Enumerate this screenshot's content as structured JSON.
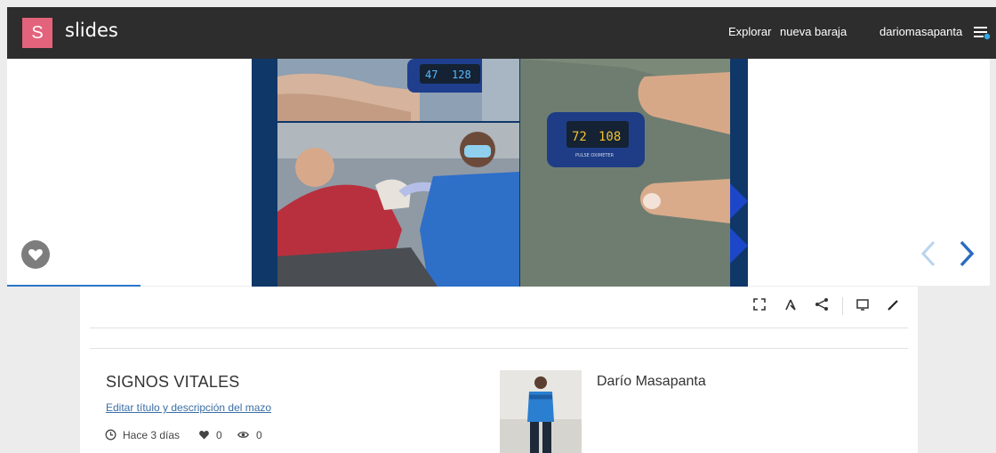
{
  "header": {
    "logo_letter": "S",
    "logo_text": "slides",
    "nav": {
      "explore": "Explorar",
      "new_deck": "nueva baraja",
      "user": "dariomasapanta"
    }
  },
  "deck": {
    "title": "SIGNOS VITALES",
    "edit_link": "Editar título y descripción del mazo",
    "time_ago": "Hace 3 días",
    "likes": "0",
    "views": "0",
    "author": "Darío Masapanta"
  },
  "slide": {
    "oximeter_top_reading_1": "47",
    "oximeter_top_reading_2": "128",
    "oximeter_right_reading_1": "72",
    "oximeter_right_reading_2": "108",
    "oximeter_label": "PULSE OXIMETER"
  },
  "toolbar_icons": [
    "fullscreen-icon",
    "fork-icon",
    "share-icon",
    "present-icon",
    "edit-icon"
  ],
  "colors": {
    "brand": "#e4637c",
    "topbar": "#2d2d2d",
    "accent": "#2a76c9",
    "slide_bg": "#0f3768"
  }
}
